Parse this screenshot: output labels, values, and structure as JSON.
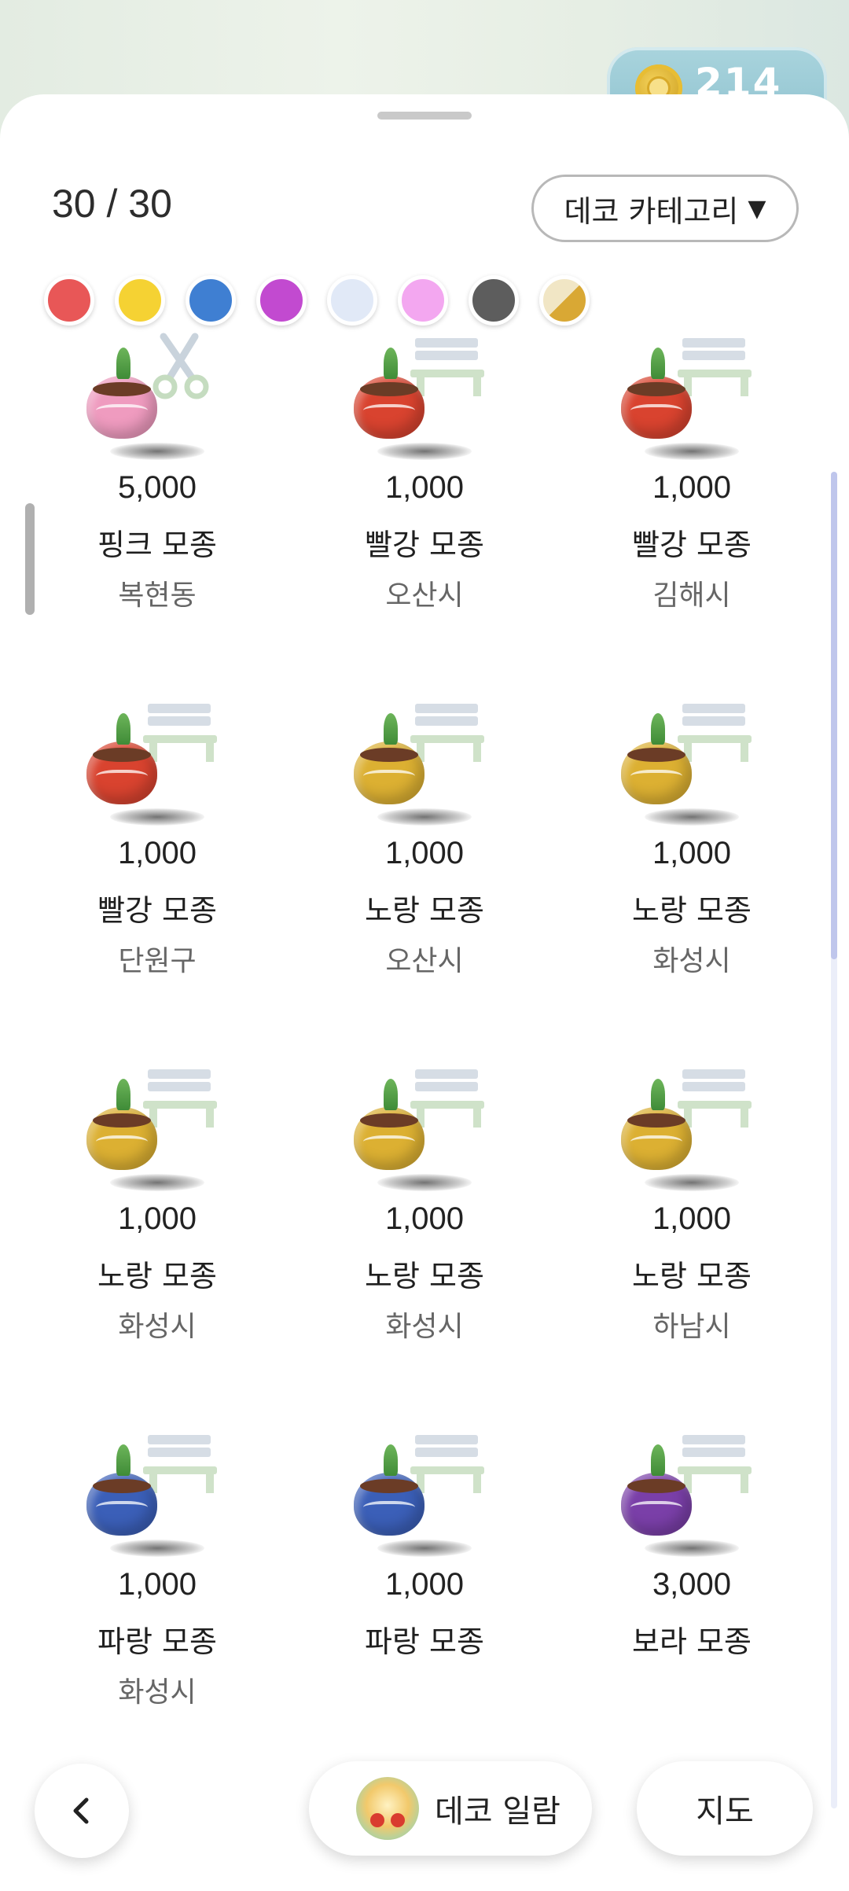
{
  "header": {
    "coin_count": "214"
  },
  "panel": {
    "count_text": "30 / 30",
    "category_button": "데코 카테고리",
    "category_arrow": "▼"
  },
  "color_filters": [
    {
      "name": "red",
      "color": "#e85757"
    },
    {
      "name": "yellow",
      "color": "#f5d233"
    },
    {
      "name": "blue",
      "color": "#3f7fd2"
    },
    {
      "name": "purple",
      "color": "#c24ad0"
    },
    {
      "name": "light-blue",
      "color": "#e1e9f7"
    },
    {
      "name": "pink",
      "color": "#f3a7f0"
    },
    {
      "name": "dark-gray",
      "color": "#5d5d5d"
    },
    {
      "name": "gold",
      "color": "linear-gradient(135deg,#f1e6c5 0%,#f1e6c5 50%,#d9a834 50%,#d9a834 100%)"
    }
  ],
  "items": [
    {
      "price": "5,000",
      "name": "핑크 모종",
      "location": "복현동",
      "pot_color": "#ef9bbf",
      "deco": "scissors"
    },
    {
      "price": "1,000",
      "name": "빨강 모종",
      "location": "오산시",
      "pot_color": "#d9432f",
      "deco": "bench"
    },
    {
      "price": "1,000",
      "name": "빨강 모종",
      "location": "김해시",
      "pot_color": "#d9432f",
      "deco": "bench"
    },
    {
      "price": "1,000",
      "name": "빨강 모종",
      "location": "단원구",
      "pot_color": "#d9432f",
      "deco": "bench"
    },
    {
      "price": "1,000",
      "name": "노랑 모종",
      "location": "오산시",
      "pot_color": "#dcb032",
      "deco": "bench"
    },
    {
      "price": "1,000",
      "name": "노랑 모종",
      "location": "화성시",
      "pot_color": "#dcb032",
      "deco": "bench"
    },
    {
      "price": "1,000",
      "name": "노랑 모종",
      "location": "화성시",
      "pot_color": "#dcb032",
      "deco": "bench"
    },
    {
      "price": "1,000",
      "name": "노랑 모종",
      "location": "화성시",
      "pot_color": "#dcb032",
      "deco": "bench"
    },
    {
      "price": "1,000",
      "name": "노랑 모종",
      "location": "하남시",
      "pot_color": "#dcb032",
      "deco": "bench"
    },
    {
      "price": "1,000",
      "name": "파랑 모종",
      "location": "화성시",
      "pot_color": "#3b5fb8",
      "deco": "bench"
    },
    {
      "price": "1,000",
      "name": "파랑 모종",
      "location": "",
      "pot_color": "#3b5fb8",
      "deco": "bench"
    },
    {
      "price": "3,000",
      "name": "보라 모종",
      "location": "",
      "pot_color": "#7a3fa8",
      "deco": "bench"
    }
  ],
  "bottom_bar": {
    "back_icon": "chevron-left-icon",
    "deco_album_label": "데코 일람",
    "map_label": "지도"
  }
}
